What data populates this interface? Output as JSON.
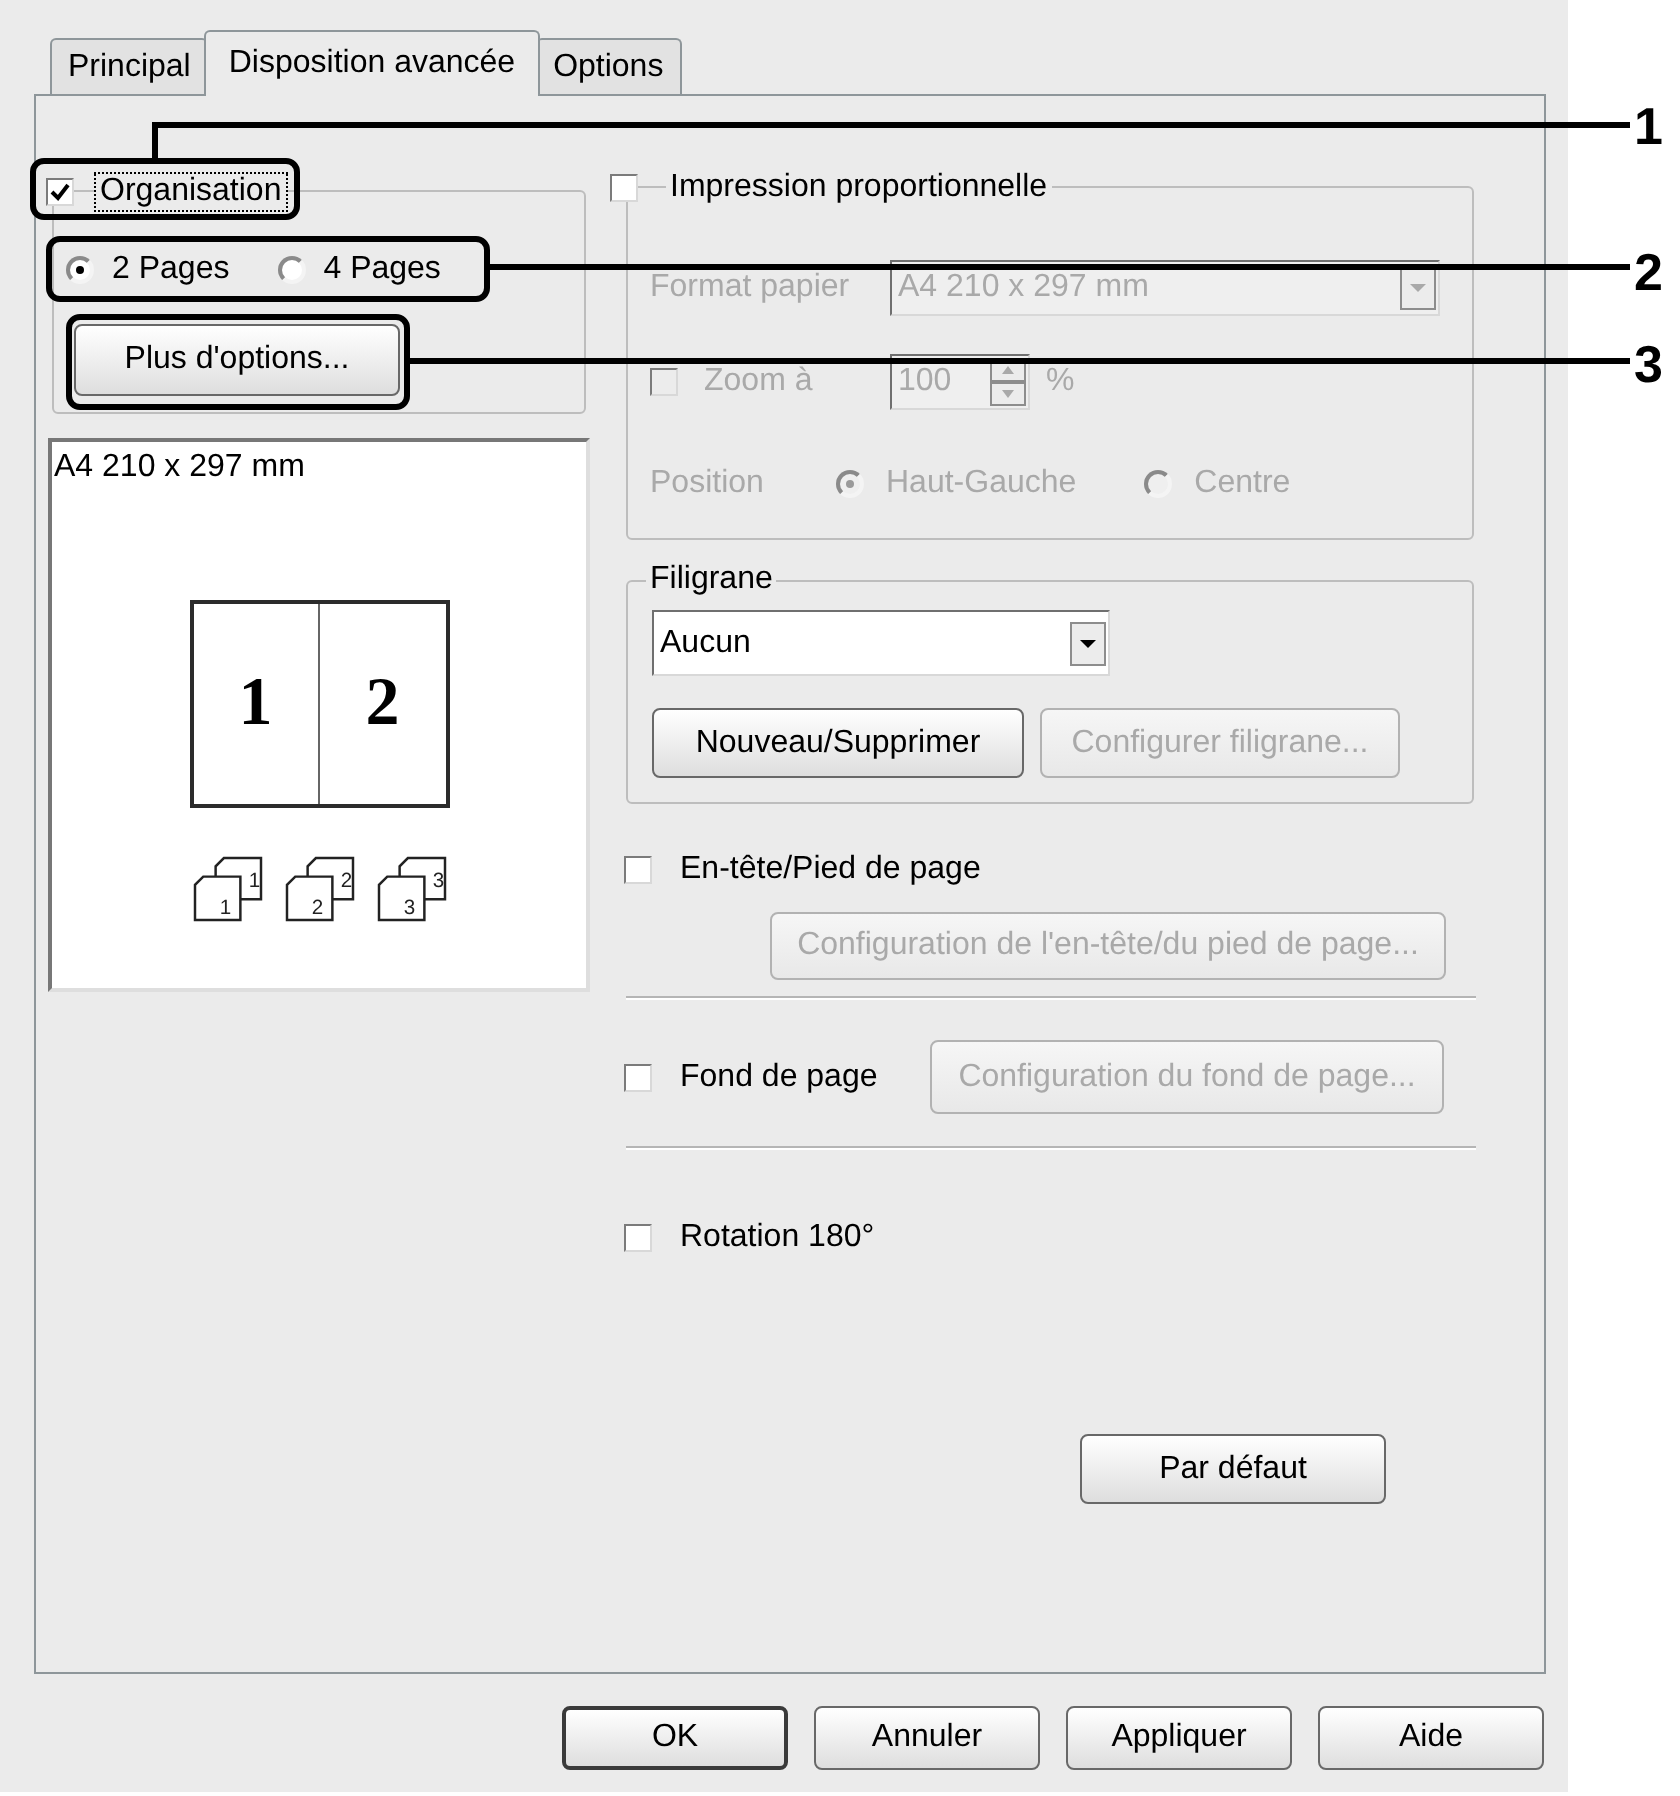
{
  "tabs": [
    {
      "label": "Principal",
      "selected": false
    },
    {
      "label": "Disposition avancée",
      "selected": true
    },
    {
      "label": "Options",
      "selected": false
    }
  ],
  "organisation": {
    "label": "Organisation",
    "checked": true,
    "focused": true,
    "options": [
      {
        "label": "2 Pages",
        "selected": true
      },
      {
        "label": "4 Pages",
        "selected": false
      }
    ],
    "more_options_button": "Plus d'options..."
  },
  "preview": {
    "paper_size": "A4 210 x 297 mm",
    "pages": [
      "1",
      "2"
    ],
    "copies": [
      {
        "back": "1",
        "front": "1"
      },
      {
        "back": "2",
        "front": "2"
      },
      {
        "back": "3",
        "front": "3"
      }
    ]
  },
  "proportional": {
    "label": "Impression proportionnelle",
    "checked": false,
    "disabled": true,
    "paper_label": "Format papier",
    "paper_value": "A4 210 x 297 mm",
    "zoom_label": "Zoom à",
    "zoom_checked": false,
    "zoom_value": "100",
    "zoom_unit": "%",
    "position_label": "Position",
    "positions": [
      {
        "label": "Haut-Gauche",
        "selected": true
      },
      {
        "label": "Centre",
        "selected": false
      }
    ]
  },
  "watermark": {
    "label": "Filigrane",
    "value": "Aucun",
    "buttons": [
      {
        "label": "Nouveau/Supprimer",
        "disabled": false
      },
      {
        "label": "Configurer filigrane...",
        "disabled": true
      }
    ]
  },
  "header_footer": {
    "label": "En-tête/Pied de page",
    "checked": false,
    "button": {
      "label": "Configuration de l'en-tête/du pied de page...",
      "disabled": true
    }
  },
  "background": {
    "label": "Fond de page",
    "checked": false,
    "button": {
      "label": "Configuration du fond de page...",
      "disabled": true
    }
  },
  "rotation": {
    "label": "Rotation 180°",
    "checked": false
  },
  "default_button": "Par défaut",
  "buttons": [
    {
      "label": "OK",
      "default": true
    },
    {
      "label": "Annuler",
      "default": false
    },
    {
      "label": "Appliquer",
      "default": false
    },
    {
      "label": "Aide",
      "default": false
    }
  ],
  "callouts": [
    "1",
    "2",
    "3"
  ]
}
